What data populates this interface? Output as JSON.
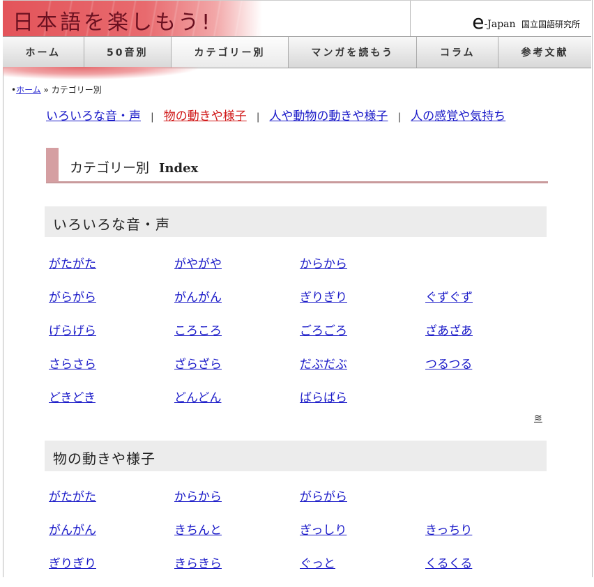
{
  "header": {
    "title": "日本語を楽しもう!",
    "partner_e": "e",
    "partner_name": "-Japan",
    "partner_org": "国立国語研究所"
  },
  "nav": {
    "items": [
      {
        "label": "ホーム"
      },
      {
        "label": "50音別"
      },
      {
        "label": "カテゴリー別",
        "active": true
      },
      {
        "label": "マンガを読もう"
      },
      {
        "label": "コラム"
      },
      {
        "label": "参考文献"
      }
    ]
  },
  "breadcrumb": {
    "bullet": "•",
    "home": "ホーム",
    "sep": " » ",
    "current": "カテゴリー別"
  },
  "category_nav": {
    "items": [
      "いろいろな音・声",
      "物の動きや様子",
      "人や動物の動きや様子",
      "人の感覚や気持ち"
    ],
    "current_index": 1,
    "separator": "|"
  },
  "index_heading": {
    "text": "カテゴリー別",
    "bold": "Index"
  },
  "sections": [
    {
      "title": "いろいろな音・声",
      "rows": [
        [
          "がたがた",
          "がやがや",
          "からから",
          ""
        ],
        [
          "がらがら",
          "がんがん",
          "ぎりぎり",
          "ぐずぐず"
        ],
        [
          "げらげら",
          "ころころ",
          "ごろごろ",
          "ざあざあ"
        ],
        [
          "さらさら",
          "ざらざら",
          "だぶだぶ",
          "つるつる"
        ],
        [
          "どきどき",
          "どんどん",
          "ばらばら",
          ""
        ]
      ]
    },
    {
      "title": "物の動きや様子",
      "rows": [
        [
          "がたがた",
          "からから",
          "がらがら",
          ""
        ],
        [
          "がんがん",
          "きちんと",
          "ぎっしり",
          "きっちり"
        ],
        [
          "ぎりぎり",
          "きらきら",
          "ぐっと",
          "くるくる"
        ]
      ]
    }
  ],
  "back_to_top_icon": "double-chevron-up-icon",
  "back_to_top_glyph": "≋"
}
